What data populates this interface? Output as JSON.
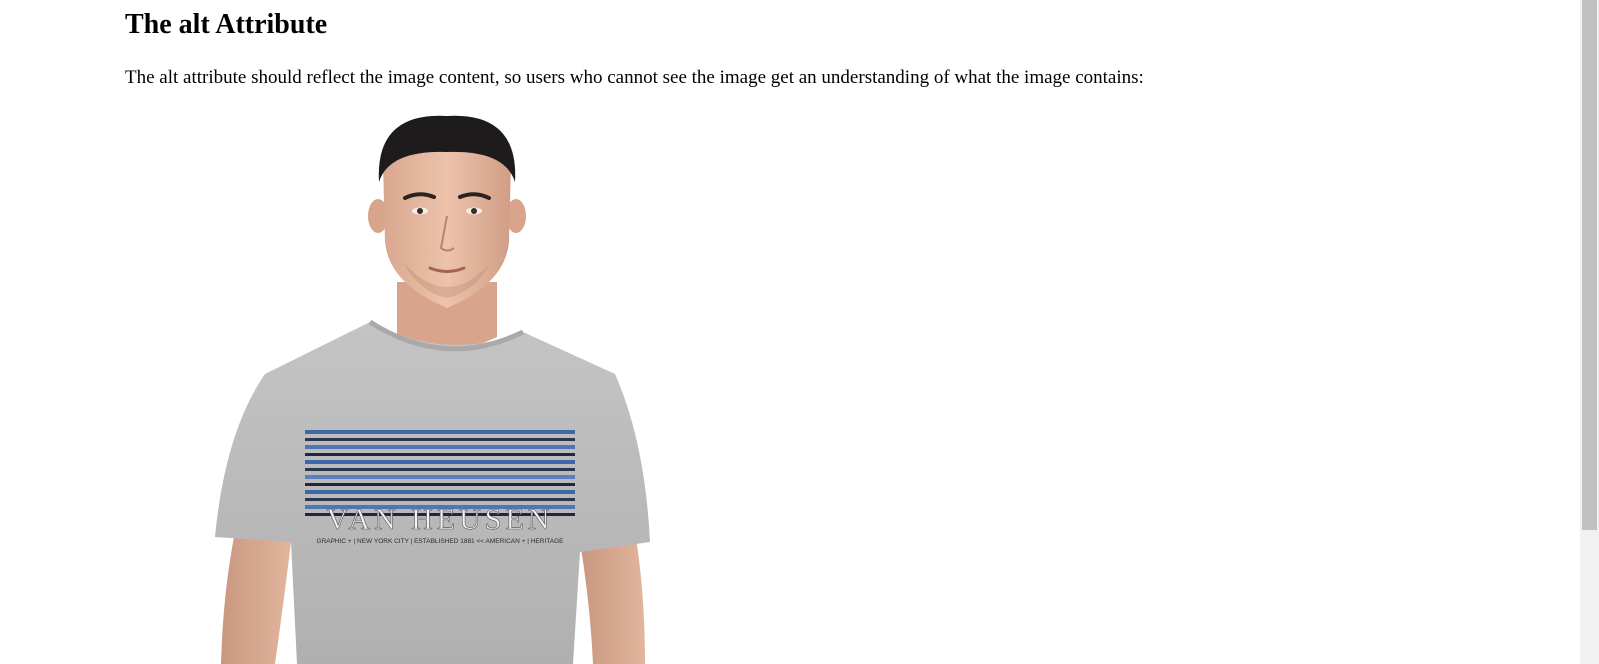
{
  "heading": "The alt Attribute",
  "intro_text": "The alt attribute should reflect the image content, so users who cannot see the image get an understanding of what the image contains:",
  "image": {
    "shirt_print_brand": "VAN HEUSEN",
    "shirt_print_tagline": "GRAPHIC + | NEW YORK CITY | ESTABLISHED 1881 << AMERICAN + | HERITAGE"
  },
  "scrollbar": {
    "position_fraction": 0.0
  },
  "colors": {
    "background": "#ffffff",
    "text": "#000000",
    "shirt": "#b9b9b9",
    "stripe_blue": "#3d67a8",
    "stripe_dark": "#2b3550",
    "scroll_track": "#f1f1f1",
    "scroll_thumb": "#c1c1c1"
  }
}
